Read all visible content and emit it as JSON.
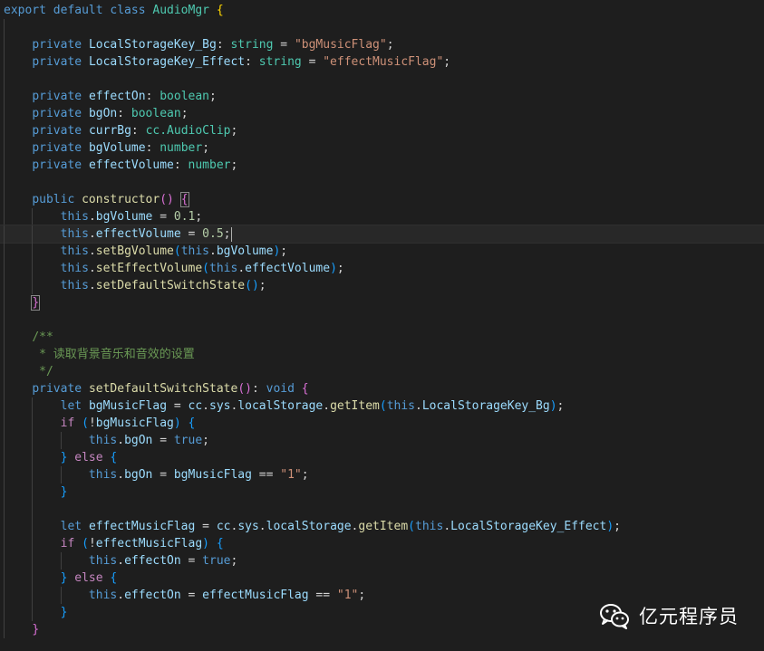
{
  "editor": {
    "language": "typescript",
    "colors": {
      "background": "#1e1e1e",
      "keyword": "#569cd6",
      "control": "#c586c0",
      "identifier": "#9cdcfe",
      "type": "#4ec9b0",
      "function": "#dcdcaa",
      "string": "#ce9178",
      "number": "#b5cea8",
      "comment": "#6a9955",
      "bracket_level1": "#ffd700",
      "bracket_level2": "#da70d6",
      "bracket_level3": "#179fff"
    },
    "lines": [
      {
        "indent": 0,
        "tokens": [
          [
            "kw",
            "export default class "
          ],
          [
            "type",
            "AudioMgr"
          ],
          [
            "b1",
            " {"
          ]
        ]
      },
      {
        "indent": 1,
        "tokens": []
      },
      {
        "indent": 1,
        "tokens": [
          [
            "kw",
            "private "
          ],
          [
            "id",
            "LocalStorageKey_Bg"
          ],
          [
            "p",
            ": "
          ],
          [
            "type",
            "string"
          ],
          [
            "p",
            " = "
          ],
          [
            "str",
            "\"bgMusicFlag\""
          ],
          [
            "p",
            ";"
          ]
        ]
      },
      {
        "indent": 1,
        "tokens": [
          [
            "kw",
            "private "
          ],
          [
            "id",
            "LocalStorageKey_Effect"
          ],
          [
            "p",
            ": "
          ],
          [
            "type",
            "string"
          ],
          [
            "p",
            " = "
          ],
          [
            "str",
            "\"effectMusicFlag\""
          ],
          [
            "p",
            ";"
          ]
        ]
      },
      {
        "indent": 1,
        "tokens": []
      },
      {
        "indent": 1,
        "tokens": [
          [
            "kw",
            "private "
          ],
          [
            "id",
            "effectOn"
          ],
          [
            "p",
            ": "
          ],
          [
            "type",
            "boolean"
          ],
          [
            "p",
            ";"
          ]
        ]
      },
      {
        "indent": 1,
        "tokens": [
          [
            "kw",
            "private "
          ],
          [
            "id",
            "bgOn"
          ],
          [
            "p",
            ": "
          ],
          [
            "type",
            "boolean"
          ],
          [
            "p",
            ";"
          ]
        ]
      },
      {
        "indent": 1,
        "tokens": [
          [
            "kw",
            "private "
          ],
          [
            "id",
            "currBg"
          ],
          [
            "p",
            ": "
          ],
          [
            "type",
            "cc.AudioClip"
          ],
          [
            "p",
            ";"
          ]
        ]
      },
      {
        "indent": 1,
        "tokens": [
          [
            "kw",
            "private "
          ],
          [
            "id",
            "bgVolume"
          ],
          [
            "p",
            ": "
          ],
          [
            "type",
            "number"
          ],
          [
            "p",
            ";"
          ]
        ]
      },
      {
        "indent": 1,
        "tokens": [
          [
            "kw",
            "private "
          ],
          [
            "id",
            "effectVolume"
          ],
          [
            "p",
            ": "
          ],
          [
            "type",
            "number"
          ],
          [
            "p",
            ";"
          ]
        ]
      },
      {
        "indent": 1,
        "tokens": []
      },
      {
        "indent": 1,
        "tokens": [
          [
            "kw",
            "public "
          ],
          [
            "fn",
            "constructor"
          ],
          [
            "b2",
            "()"
          ],
          [
            "p",
            " "
          ],
          [
            "b2hl",
            "{"
          ]
        ]
      },
      {
        "indent": 2,
        "tokens": [
          [
            "kw",
            "this"
          ],
          [
            "p",
            "."
          ],
          [
            "id",
            "bgVolume"
          ],
          [
            "p",
            " = "
          ],
          [
            "num",
            "0.1"
          ],
          [
            "p",
            ";"
          ]
        ]
      },
      {
        "indent": 2,
        "current": true,
        "tokens": [
          [
            "kw",
            "this"
          ],
          [
            "p",
            "."
          ],
          [
            "id",
            "effectVolume"
          ],
          [
            "p",
            " = "
          ],
          [
            "num",
            "0.5"
          ],
          [
            "p",
            ";"
          ],
          [
            "cursor",
            ""
          ]
        ]
      },
      {
        "indent": 2,
        "tokens": [
          [
            "kw",
            "this"
          ],
          [
            "p",
            "."
          ],
          [
            "fn",
            "setBgVolume"
          ],
          [
            "b3",
            "("
          ],
          [
            "kw",
            "this"
          ],
          [
            "p",
            "."
          ],
          [
            "id",
            "bgVolume"
          ],
          [
            "b3",
            ")"
          ],
          [
            "p",
            ";"
          ]
        ]
      },
      {
        "indent": 2,
        "tokens": [
          [
            "kw",
            "this"
          ],
          [
            "p",
            "."
          ],
          [
            "fn",
            "setEffectVolume"
          ],
          [
            "b3",
            "("
          ],
          [
            "kw",
            "this"
          ],
          [
            "p",
            "."
          ],
          [
            "id",
            "effectVolume"
          ],
          [
            "b3",
            ")"
          ],
          [
            "p",
            ";"
          ]
        ]
      },
      {
        "indent": 2,
        "tokens": [
          [
            "kw",
            "this"
          ],
          [
            "p",
            "."
          ],
          [
            "fn",
            "setDefaultSwitchState"
          ],
          [
            "b3",
            "()"
          ],
          [
            "p",
            ";"
          ]
        ]
      },
      {
        "indent": 1,
        "tokens": [
          [
            "b2hl",
            "}"
          ]
        ]
      },
      {
        "indent": 1,
        "tokens": []
      },
      {
        "indent": 1,
        "tokens": [
          [
            "com",
            "/**"
          ]
        ]
      },
      {
        "indent": 1,
        "tokens": [
          [
            "com",
            " * "
          ],
          [
            "comcjk",
            "读取背景音乐和音效的设置"
          ]
        ]
      },
      {
        "indent": 1,
        "tokens": [
          [
            "com",
            " */"
          ]
        ]
      },
      {
        "indent": 1,
        "tokens": [
          [
            "kw",
            "private "
          ],
          [
            "fn",
            "setDefaultSwitchState"
          ],
          [
            "b2",
            "()"
          ],
          [
            "p",
            ": "
          ],
          [
            "kw",
            "void"
          ],
          [
            "p",
            " "
          ],
          [
            "b2",
            "{"
          ]
        ]
      },
      {
        "indent": 2,
        "tokens": [
          [
            "kw",
            "let "
          ],
          [
            "id",
            "bgMusicFlag"
          ],
          [
            "p",
            " = "
          ],
          [
            "id",
            "cc"
          ],
          [
            "p",
            "."
          ],
          [
            "id",
            "sys"
          ],
          [
            "p",
            "."
          ],
          [
            "id",
            "localStorage"
          ],
          [
            "p",
            "."
          ],
          [
            "fn",
            "getItem"
          ],
          [
            "b3",
            "("
          ],
          [
            "kw",
            "this"
          ],
          [
            "p",
            "."
          ],
          [
            "id",
            "LocalStorageKey_Bg"
          ],
          [
            "b3",
            ")"
          ],
          [
            "p",
            ";"
          ]
        ]
      },
      {
        "indent": 2,
        "tokens": [
          [
            "ctl",
            "if "
          ],
          [
            "b3",
            "("
          ],
          [
            "p",
            "!"
          ],
          [
            "id",
            "bgMusicFlag"
          ],
          [
            "b3",
            ")"
          ],
          [
            "p",
            " "
          ],
          [
            "b3",
            "{"
          ]
        ]
      },
      {
        "indent": 3,
        "tokens": [
          [
            "kw",
            "this"
          ],
          [
            "p",
            "."
          ],
          [
            "id",
            "bgOn"
          ],
          [
            "p",
            " = "
          ],
          [
            "kw",
            "true"
          ],
          [
            "p",
            ";"
          ]
        ]
      },
      {
        "indent": 2,
        "tokens": [
          [
            "b3",
            "}"
          ],
          [
            "p",
            " "
          ],
          [
            "ctl",
            "else"
          ],
          [
            "p",
            " "
          ],
          [
            "b3",
            "{"
          ]
        ]
      },
      {
        "indent": 3,
        "tokens": [
          [
            "kw",
            "this"
          ],
          [
            "p",
            "."
          ],
          [
            "id",
            "bgOn"
          ],
          [
            "p",
            " = "
          ],
          [
            "id",
            "bgMusicFlag"
          ],
          [
            "p",
            " == "
          ],
          [
            "str",
            "\"1\""
          ],
          [
            "p",
            ";"
          ]
        ]
      },
      {
        "indent": 2,
        "tokens": [
          [
            "b3",
            "}"
          ]
        ]
      },
      {
        "indent": 2,
        "tokens": []
      },
      {
        "indent": 2,
        "tokens": [
          [
            "kw",
            "let "
          ],
          [
            "id",
            "effectMusicFlag"
          ],
          [
            "p",
            " = "
          ],
          [
            "id",
            "cc"
          ],
          [
            "p",
            "."
          ],
          [
            "id",
            "sys"
          ],
          [
            "p",
            "."
          ],
          [
            "id",
            "localStorage"
          ],
          [
            "p",
            "."
          ],
          [
            "fn",
            "getItem"
          ],
          [
            "b3",
            "("
          ],
          [
            "kw",
            "this"
          ],
          [
            "p",
            "."
          ],
          [
            "id",
            "LocalStorageKey_Effect"
          ],
          [
            "b3",
            ")"
          ],
          [
            "p",
            ";"
          ]
        ]
      },
      {
        "indent": 2,
        "tokens": [
          [
            "ctl",
            "if "
          ],
          [
            "b3",
            "("
          ],
          [
            "p",
            "!"
          ],
          [
            "id",
            "effectMusicFlag"
          ],
          [
            "b3",
            ")"
          ],
          [
            "p",
            " "
          ],
          [
            "b3",
            "{"
          ]
        ]
      },
      {
        "indent": 3,
        "tokens": [
          [
            "kw",
            "this"
          ],
          [
            "p",
            "."
          ],
          [
            "id",
            "effectOn"
          ],
          [
            "p",
            " = "
          ],
          [
            "kw",
            "true"
          ],
          [
            "p",
            ";"
          ]
        ]
      },
      {
        "indent": 2,
        "tokens": [
          [
            "b3",
            "}"
          ],
          [
            "p",
            " "
          ],
          [
            "ctl",
            "else"
          ],
          [
            "p",
            " "
          ],
          [
            "b3",
            "{"
          ]
        ]
      },
      {
        "indent": 3,
        "tokens": [
          [
            "kw",
            "this"
          ],
          [
            "p",
            "."
          ],
          [
            "id",
            "effectOn"
          ],
          [
            "p",
            " = "
          ],
          [
            "id",
            "effectMusicFlag"
          ],
          [
            "p",
            " == "
          ],
          [
            "str",
            "\"1\""
          ],
          [
            "p",
            ";"
          ]
        ]
      },
      {
        "indent": 2,
        "tokens": [
          [
            "b3",
            "}"
          ]
        ]
      },
      {
        "indent": 1,
        "tokens": [
          [
            "b2",
            "}"
          ]
        ]
      }
    ]
  },
  "watermark": {
    "icon": "wechat-icon",
    "text": "亿元程序员"
  }
}
